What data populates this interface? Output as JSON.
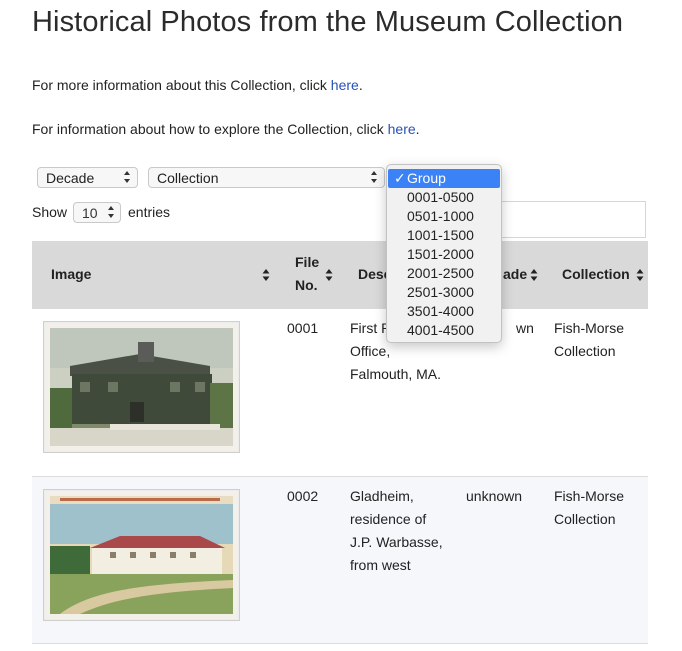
{
  "page": {
    "title": "Historical Photos from the Museum Collection",
    "info1_prefix": "For more information about this Collection, click ",
    "info1_link": "here",
    "info1_suffix": ".",
    "info2_prefix": "For information about how to explore the Collection, click ",
    "info2_link": "here",
    "info2_suffix": "."
  },
  "filters": {
    "decade_label": "Decade",
    "collection_label": "Collection",
    "group_dropdown": {
      "check": "✓",
      "selected": "Group",
      "options": [
        "0001-0500",
        "0501-1000",
        "1001-1500",
        "1501-2000",
        "2001-2500",
        "2501-3000",
        "3501-4000",
        "4001-4500"
      ]
    }
  },
  "length": {
    "show": "Show",
    "value": "10",
    "entries": "entries"
  },
  "table": {
    "headers": {
      "image": "Image",
      "file_no_1": "File",
      "file_no_2": "No.",
      "description": "Desc",
      "decade": "ade",
      "collection": "Collection"
    },
    "rows": [
      {
        "file_no": "0001",
        "desc_lines": [
          "First P",
          "Office,",
          "Falmouth, MA."
        ],
        "decade": "wn",
        "collection_lines": [
          "Fish-Morse",
          "Collection"
        ]
      },
      {
        "file_no": "0002",
        "desc_lines": [
          "Gladheim,",
          "residence of",
          "J.P. Warbasse,",
          "from west"
        ],
        "decade": "unknown",
        "collection_lines": [
          "Fish-Morse",
          "Collection"
        ]
      }
    ]
  },
  "colors": {
    "link": "#2a50b8",
    "header_bg": "#d9d9d9",
    "selected_option": "#3b82f6"
  }
}
